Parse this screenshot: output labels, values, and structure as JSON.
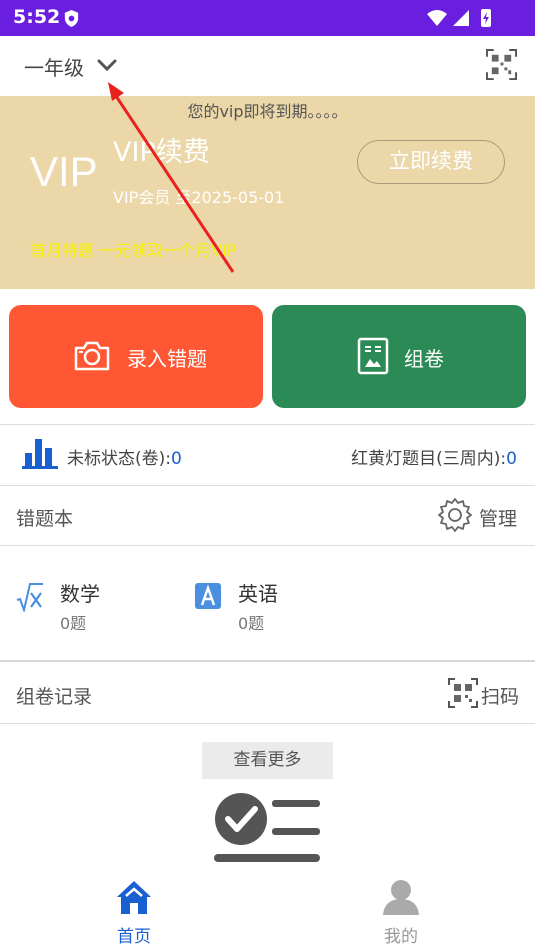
{
  "status_bar": {
    "time": "5:52",
    "icons": [
      "shield-icon",
      "wifi-icon",
      "signal-icon",
      "battery-icon"
    ]
  },
  "header": {
    "grade": "一年级",
    "grade_icon": "chevron-down-icon",
    "scan_icon": "qr-code-icon"
  },
  "vip_banner": {
    "notice": "您的vip即将到期。。。。",
    "vip_logo": "VIP",
    "title": "VIP续费",
    "expiry": "VIP会员 至2025-05-01",
    "renew_label": "立即续费",
    "promo": "首月特惠 一元领取一个月VIP"
  },
  "actions": [
    {
      "label": "录入错题",
      "icon": "camera-icon",
      "color": "#ff5733"
    },
    {
      "label": "组卷",
      "icon": "paper-icon",
      "color": "#2b8a55"
    }
  ],
  "stats": {
    "unmarked_label": "未标状态(卷):",
    "unmarked_value": "0",
    "traffic_label": "红黄灯题目(三周内):",
    "traffic_value": "0"
  },
  "mistake_book": {
    "title": "错题本",
    "manage_label": "管理",
    "subjects": [
      {
        "name": "数学",
        "count": "0题",
        "icon": "sqrt-icon"
      },
      {
        "name": "英语",
        "count": "0题",
        "icon": "letter-a-icon"
      }
    ]
  },
  "paper_records": {
    "title": "组卷记录",
    "scan_label": "扫码",
    "more_label": "查看更多"
  },
  "tab_bar": [
    {
      "label": "首页",
      "icon": "home-icon",
      "active": true
    },
    {
      "label": "我的",
      "icon": "user-icon",
      "active": false
    }
  ],
  "colors": {
    "status_bar": "#6a1fe0",
    "banner": "#ebd7a8",
    "accent_blue": "#1a5fd0",
    "promo": "#f6f000",
    "annotation_arrow": "#e8231f"
  }
}
